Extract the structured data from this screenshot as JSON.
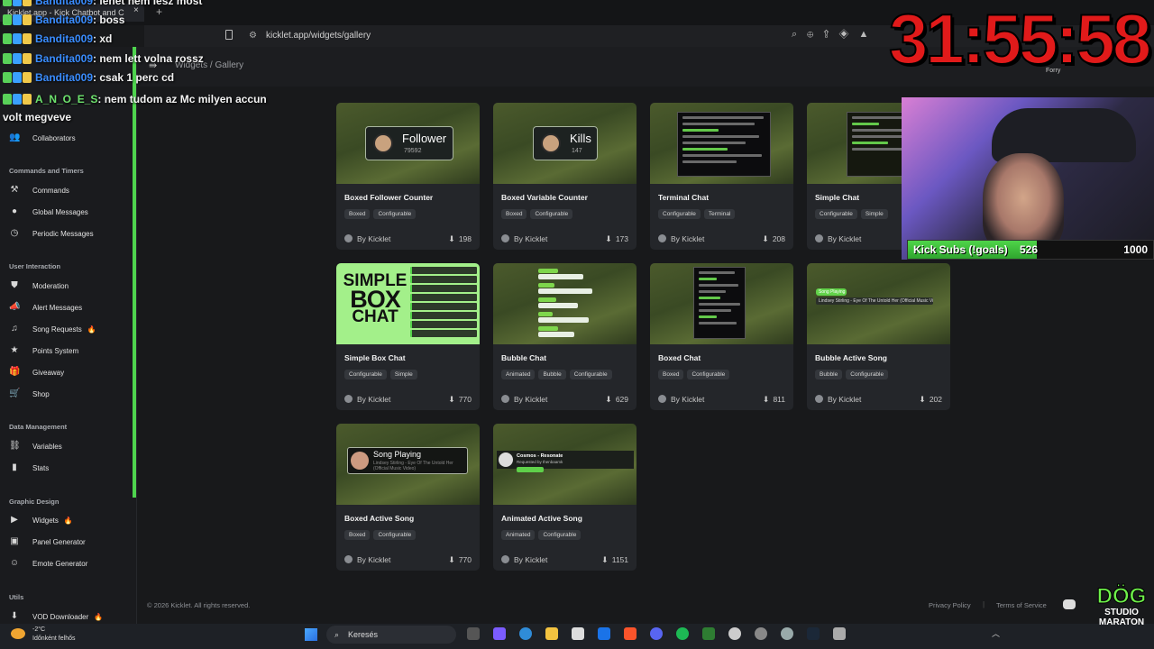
{
  "browser": {
    "tab_title": "Kicklet.app - Kick Chatbot and C",
    "tab_close": "×",
    "new_tab": "+",
    "url": "kicklet.app/widgets/gallery"
  },
  "header": {
    "menu_icon": "sidebar-toggle-icon",
    "breadcrumb": "Widgets / Gallery"
  },
  "sidebar": {
    "top_items": [
      {
        "label": "Collaborators",
        "icon": "users-icon"
      }
    ],
    "sections": [
      {
        "title": "Commands and Timers",
        "items": [
          {
            "label": "Commands",
            "icon": "wand-icon"
          },
          {
            "label": "Global Messages",
            "icon": "chat-icon"
          },
          {
            "label": "Periodic Messages",
            "icon": "clock-icon"
          }
        ]
      },
      {
        "title": "User Interaction",
        "items": [
          {
            "label": "Moderation",
            "icon": "shield-icon"
          },
          {
            "label": "Alert Messages",
            "icon": "megaphone-icon"
          },
          {
            "label": "Song Requests",
            "icon": "music-icon",
            "badge": "🔥"
          },
          {
            "label": "Points System",
            "icon": "star-icon"
          },
          {
            "label": "Giveaway",
            "icon": "gift-icon"
          },
          {
            "label": "Shop",
            "icon": "cart-icon"
          }
        ]
      },
      {
        "title": "Data Management",
        "items": [
          {
            "label": "Variables",
            "icon": "link-icon"
          },
          {
            "label": "Stats",
            "icon": "bar-chart-icon"
          }
        ]
      },
      {
        "title": "Graphic Design",
        "items": [
          {
            "label": "Widgets",
            "icon": "video-icon",
            "badge": "🔥"
          },
          {
            "label": "Panel Generator",
            "icon": "panel-icon"
          },
          {
            "label": "Emote Generator",
            "icon": "smile-icon"
          }
        ]
      },
      {
        "title": "Utils",
        "items": [
          {
            "label": "VOD Downloader",
            "icon": "download-icon",
            "badge": "🔥"
          }
        ]
      }
    ]
  },
  "widgets": [
    {
      "title": "Boxed Follower Counter",
      "tags": [
        "Boxed",
        "Configurable"
      ],
      "author": "By Kicklet",
      "downloads": "198",
      "preview_label": "Follower",
      "preview_value": "79592"
    },
    {
      "title": "Boxed Variable Counter",
      "tags": [
        "Boxed",
        "Configurable"
      ],
      "author": "By Kicklet",
      "downloads": "173",
      "preview_label": "Kills",
      "preview_value": "147"
    },
    {
      "title": "Terminal Chat",
      "tags": [
        "Configurable",
        "Terminal"
      ],
      "author": "By Kicklet",
      "downloads": "208"
    },
    {
      "title": "Simple Chat",
      "tags": [
        "Configurable",
        "Simple"
      ],
      "author": "By Kicklet",
      "downloads": ""
    },
    {
      "title": "Simple Box Chat",
      "tags": [
        "Configurable",
        "Simple"
      ],
      "author": "By Kicklet",
      "downloads": "770",
      "preview_line1": "SIMPLE",
      "preview_line2": "BOX",
      "preview_line3": "CHAT"
    },
    {
      "title": "Bubble Chat",
      "tags": [
        "Animated",
        "Bubble",
        "Configurable"
      ],
      "author": "By Kicklet",
      "downloads": "629"
    },
    {
      "title": "Boxed Chat",
      "tags": [
        "Boxed",
        "Configurable"
      ],
      "author": "By Kicklet",
      "downloads": "811"
    },
    {
      "title": "Bubble Active Song",
      "tags": [
        "Bubble",
        "Configurable"
      ],
      "author": "By Kicklet",
      "downloads": "202",
      "preview_pill": "Song Playing",
      "preview_song": "Lindsey Stirling - Eye Of The Untold Her (Official Music Video)"
    },
    {
      "title": "Boxed Active Song",
      "tags": [
        "Boxed",
        "Configurable"
      ],
      "author": "By Kicklet",
      "downloads": "770",
      "preview_label": "Song Playing",
      "preview_song": "Lindsey Stirling - Eye Of The Untold Her (Official Music Video)"
    },
    {
      "title": "Animated Active Song",
      "tags": [
        "Animated",
        "Configurable"
      ],
      "author": "By Kicklet",
      "downloads": "1151",
      "preview_label": "Cosmos - Resonate",
      "preview_sub": "Requested by thenbaamk"
    }
  ],
  "footer": {
    "copyright": "© 2026 Kicklet. All rights reserved.",
    "privacy": "Privacy Policy",
    "separator": "|",
    "terms": "Terms of Service"
  },
  "stream_overlay": {
    "chat": [
      {
        "user": "Bandita009",
        "text": "lehet nem lesz most"
      },
      {
        "user": "Bandita009",
        "text": "boss"
      },
      {
        "user": "Bandita009",
        "text": "xd"
      },
      {
        "user": "Bandita009",
        "text": "nem lett volna rossz"
      },
      {
        "user": "Bandita009",
        "text": "csak 1 perc cd"
      },
      {
        "user": "A_N_O_E_S",
        "text": "nem tudom az Mc milyen accun volt megveve"
      }
    ],
    "timer": "31:55:58",
    "goal_label": "Kick Subs (!goals)",
    "goal_current": "526",
    "goal_target": "1000",
    "goal_progress": 0.526,
    "name_tag": "Forry",
    "logo_line1": "DÖG",
    "logo_line2": "STUDIO",
    "logo_line3": "MARATON"
  },
  "taskbar": {
    "temperature": "-2°C",
    "weather_text": "Időnként felhős",
    "search_label": "Keresés"
  },
  "colors": {
    "accent": "#4ed44e",
    "background": "#18191b",
    "card": "#24262a",
    "timer": "#e11a1a"
  }
}
